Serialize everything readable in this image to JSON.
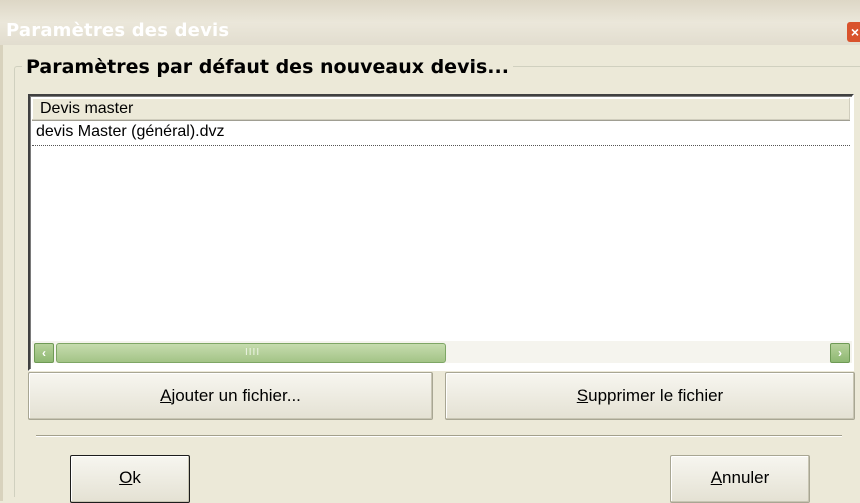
{
  "window": {
    "title": "Paramètres des devis",
    "close_glyph": "×"
  },
  "group": {
    "legend": "Paramètres par défaut des nouveaux devis..."
  },
  "list": {
    "column_header": "Devis master",
    "items": [
      {
        "label": "devis Master (général).dvz"
      }
    ],
    "scrollbar": {
      "left_arrow": "‹",
      "right_arrow": "›",
      "grip": "IIII"
    }
  },
  "buttons": {
    "add_file": {
      "mnemonic": "A",
      "rest": "jouter un fichier..."
    },
    "delete_file": {
      "mnemonic": "S",
      "rest": "upprimer le fichier"
    },
    "ok": {
      "mnemonic": "O",
      "rest": "k"
    },
    "cancel": {
      "mnemonic": "A",
      "rest": "nnuler"
    }
  },
  "colors": {
    "dialog_bg": "#ece9d8",
    "close_button": "#d9532c",
    "scroll_green": "#a3c487"
  }
}
